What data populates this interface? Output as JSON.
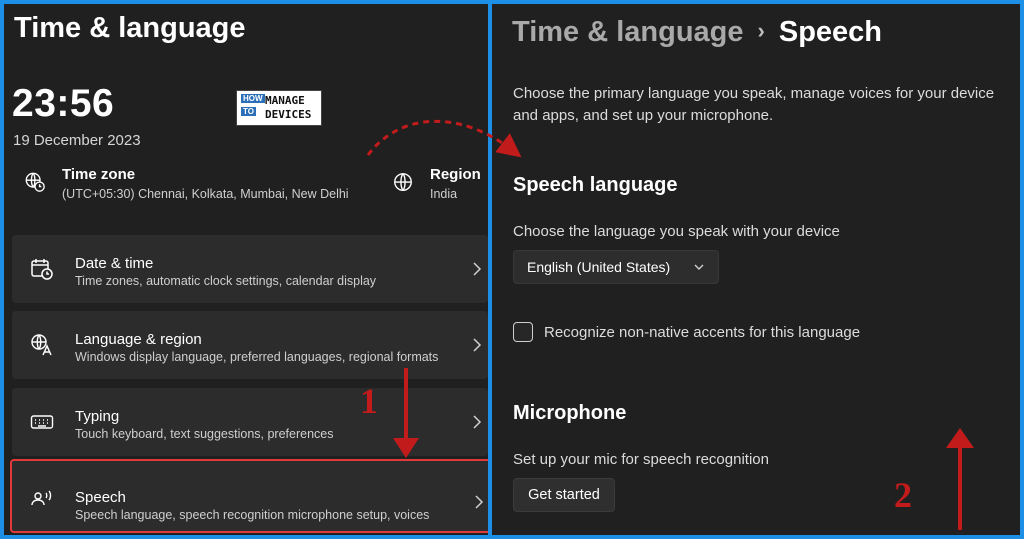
{
  "left": {
    "title": "Time & language",
    "clock": "23:56",
    "date": "19 December 2023",
    "logo": {
      "line1": "HOW",
      "line2": "TO",
      "line3": "MANAGE",
      "line4": "DEVICES"
    },
    "time_zone": {
      "label": "Time zone",
      "value": "(UTC+05:30) Chennai, Kolkata, Mumbai, New Delhi",
      "icon": "globe-clock-icon"
    },
    "region": {
      "label": "Region",
      "value": "India",
      "icon": "globe-icon"
    },
    "cards": [
      {
        "title": "Date & time",
        "subtitle": "Time zones, automatic clock settings, calendar display",
        "icon": "calendar-clock-icon"
      },
      {
        "title": "Language & region",
        "subtitle": "Windows display language, preferred languages, regional formats",
        "icon": "language-icon"
      },
      {
        "title": "Typing",
        "subtitle": "Touch keyboard, text suggestions, preferences",
        "icon": "keyboard-icon"
      },
      {
        "title": "Speech",
        "subtitle": "Speech language, speech recognition microphone setup, voices",
        "icon": "speech-icon"
      }
    ]
  },
  "right": {
    "breadcrumb": {
      "parent": "Time & language",
      "separator": "›",
      "current": "Speech"
    },
    "description": "Choose the primary language you speak, manage voices for your device and apps, and set up your microphone.",
    "speech_language": {
      "heading": "Speech language",
      "label": "Choose the language you speak with your device",
      "selected": "English (United States)",
      "checkbox_label": "Recognize non-native accents for this language"
    },
    "microphone": {
      "heading": "Microphone",
      "label": "Set up your mic for speech recognition",
      "button": "Get started"
    }
  },
  "annotations": {
    "step1": "1",
    "step2": "2",
    "color": "#c11b1b"
  },
  "colors": {
    "background": "#202020",
    "card": "#2c2c2c",
    "frame": "#1e8fe6",
    "highlight": "#e03a3a"
  }
}
